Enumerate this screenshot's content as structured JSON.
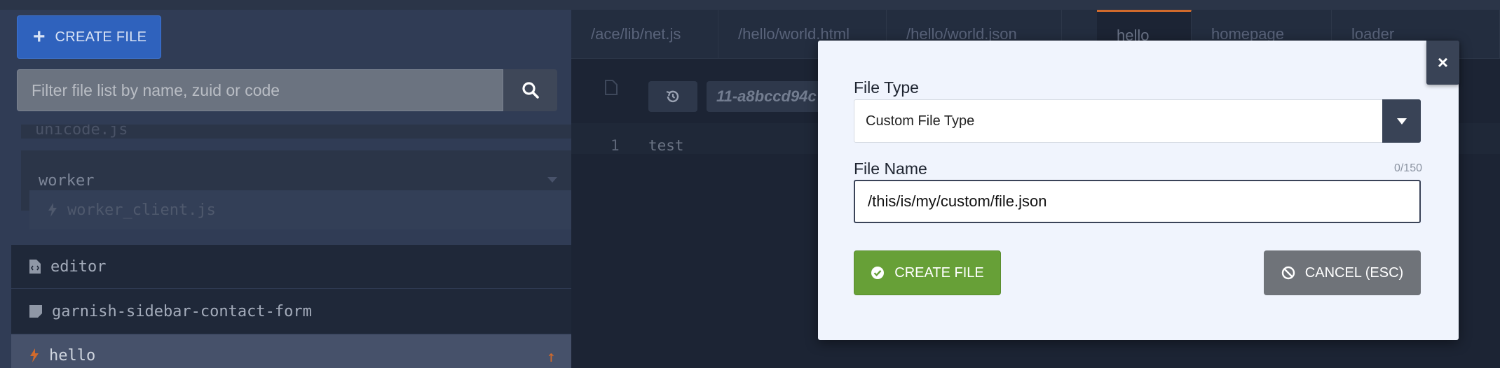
{
  "sidebar": {
    "create_button_label": "CREATE FILE",
    "filter_placeholder": "Filter file list by name, zuid or code",
    "items": [
      {
        "label": "unicode.js"
      },
      {
        "label": "worker"
      },
      {
        "label": "worker_client.js"
      },
      {
        "label": "editor"
      },
      {
        "label": "garnish-sidebar-contact-form"
      },
      {
        "label": "hello"
      }
    ]
  },
  "editor": {
    "tabs": [
      {
        "label": "/ace/lib/net.js"
      },
      {
        "label": "/hello/world.html"
      },
      {
        "label": "/hello/world.json"
      },
      {
        "label": "hello"
      },
      {
        "label": "homepage"
      },
      {
        "label": "loader"
      }
    ],
    "zuid": "11-a8bccd94c",
    "line_number": "1",
    "line_text": "test"
  },
  "modal": {
    "close_label": "×",
    "file_type_label": "File Type",
    "file_type_value": "Custom File Type",
    "file_name_label": "File Name",
    "counter": "0/150",
    "file_name_value": "/this/is/my/custom/file.json",
    "create_label": "CREATE FILE",
    "cancel_label": "CANCEL (ESC)"
  },
  "colors": {
    "accent": "#d06a2c",
    "primary_button": "#2f62bd",
    "create_button": "#67a037",
    "cancel_button": "#6f7379"
  },
  "icons": {
    "create": "plus-icon",
    "search": "search-icon",
    "file_code": "file-code-icon",
    "history": "history-icon",
    "check": "check-circle-icon",
    "cancel": "ban-icon"
  }
}
